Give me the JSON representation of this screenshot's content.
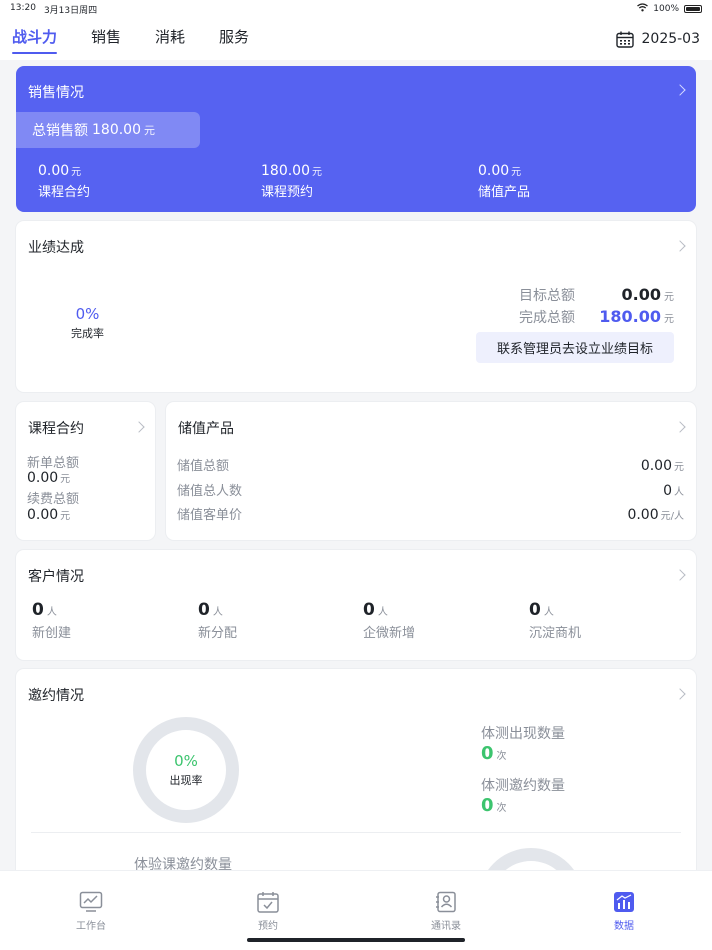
{
  "status": {
    "time": "13:20",
    "date": "3月13日周四",
    "battery": "100%"
  },
  "tabs": [
    {
      "label": "战斗力"
    },
    {
      "label": "销售"
    },
    {
      "label": "消耗"
    },
    {
      "label": "服务"
    }
  ],
  "date_picker": {
    "value": "2025-03"
  },
  "sales": {
    "title": "销售情况",
    "total_label": "总销售额",
    "total_value": "180.00",
    "unit": "元",
    "metrics": [
      {
        "value": "0.00",
        "unit": "元",
        "label": "课程合约"
      },
      {
        "value": "180.00",
        "unit": "元",
        "label": "课程预约"
      },
      {
        "value": "0.00",
        "unit": "元",
        "label": "储值产品"
      }
    ]
  },
  "performance": {
    "title": "业绩达成",
    "rate_value": "0%",
    "rate_label": "完成率",
    "target_label": "目标总额",
    "target_value": "0.00",
    "done_label": "完成总额",
    "done_value": "180.00",
    "unit": "元",
    "button": "联系管理员去设立业绩目标"
  },
  "course": {
    "title": "课程合约",
    "new_label": "新单总额",
    "new_value": "0.00",
    "renew_label": "续费总额",
    "renew_value": "0.00",
    "unit": "元"
  },
  "stored": {
    "title": "储值产品",
    "rows": [
      {
        "label": "储值总额",
        "value": "0.00",
        "unit": "元"
      },
      {
        "label": "储值总人数",
        "value": "0",
        "unit": "人"
      },
      {
        "label": "储值客单价",
        "value": "0.00",
        "unit": "元/人"
      }
    ]
  },
  "customer": {
    "title": "客户情况",
    "metrics": [
      {
        "value": "0",
        "unit": "人",
        "label": "新创建"
      },
      {
        "value": "0",
        "unit": "人",
        "label": "新分配"
      },
      {
        "value": "0",
        "unit": "人",
        "label": "企微新增"
      },
      {
        "value": "0",
        "unit": "人",
        "label": "沉淀商机"
      }
    ]
  },
  "invite": {
    "title": "邀约情况",
    "rate_value": "0%",
    "rate_label": "出现率",
    "appear_label": "体测出现数量",
    "appear_value": "0",
    "invite_label": "体测邀约数量",
    "invite_value": "0",
    "unit": "次",
    "trial_label": "体验课邀约数量"
  },
  "bottom_nav": [
    {
      "label": "工作台"
    },
    {
      "label": "预约"
    },
    {
      "label": "通讯录"
    },
    {
      "label": "数据"
    }
  ],
  "colors": {
    "accent": "#4f5bef",
    "sales_card": "#5662f1",
    "green": "#3cc46e"
  }
}
